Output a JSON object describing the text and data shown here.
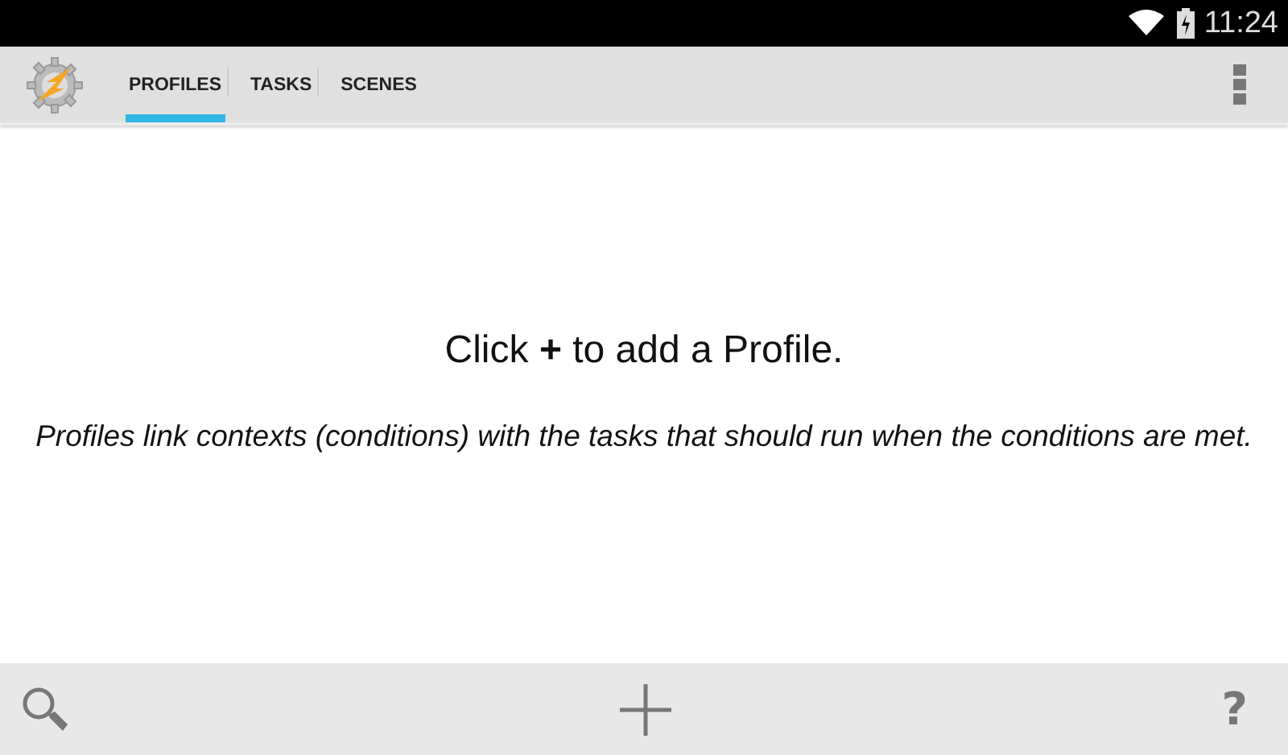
{
  "status_bar": {
    "time": "11:24"
  },
  "tabs": [
    {
      "label": "PROFILES",
      "selected": true
    },
    {
      "label": "TASKS",
      "selected": false
    },
    {
      "label": "SCENES",
      "selected": false
    }
  ],
  "empty_state": {
    "headline": "Click **+** to add a Profile.",
    "description": "Profiles link contexts (conditions) with the tasks that should run when the conditions are met."
  },
  "bottom_bar": {
    "help": "?"
  }
}
